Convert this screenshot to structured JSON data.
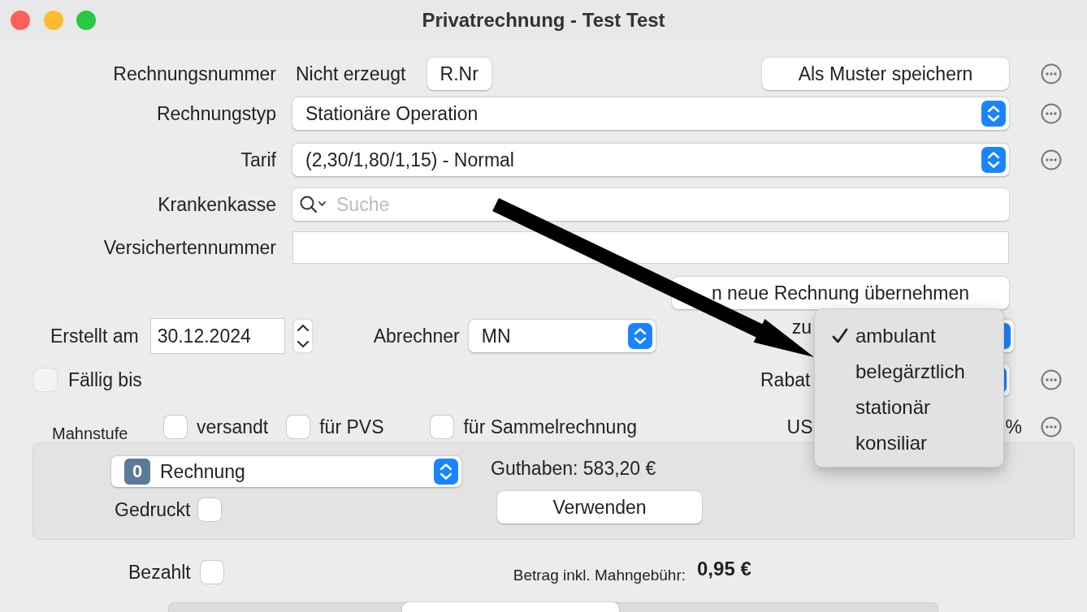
{
  "window": {
    "title": "Privatrechnung - Test Test"
  },
  "invoice_number": {
    "label": "Rechnungsnummer",
    "value": "Nicht erzeugt",
    "button": "R.Nr",
    "template_button": "Als Muster speichern",
    "more": true
  },
  "fields": [
    {
      "label": "Rechnungstyp",
      "kind": "popup",
      "value": "Stationäre Operation",
      "more": true
    },
    {
      "label": "Tarif",
      "kind": "popup",
      "value": "(2,30/1,80/1,15) - Normal",
      "more": true
    },
    {
      "label": "Krankenkasse",
      "kind": "search",
      "placeholder": "Suche",
      "more": false
    },
    {
      "label": "Versichertennummer",
      "kind": "text",
      "more": false
    }
  ],
  "apply_button": "n neue Rechnung übernehmen",
  "created": {
    "label": "Erstellt am",
    "value": "30.12.2024"
  },
  "biller": {
    "label": "Abrechner",
    "value": "MN"
  },
  "deduction": {
    "label": "zu"
  },
  "due": {
    "label": "Fällig bis",
    "checked": false
  },
  "discount": {
    "label": "Rabat"
  },
  "dunning": {
    "label": "Mahnstufe",
    "checks": [
      {
        "label": "versandt",
        "checked": false
      },
      {
        "label": "für PVS",
        "checked": false
      },
      {
        "label": "für Sammelrechnung",
        "checked": false
      }
    ]
  },
  "vat": {
    "label": "US",
    "unit": "%"
  },
  "document": {
    "badge": "0",
    "value": "Rechnung",
    "printed": {
      "label": "Gedruckt",
      "checked": false
    },
    "credit": "Guthaben: 583,20 €",
    "use_button": "Verwenden"
  },
  "paid": {
    "label": "Bezahlt",
    "checked": false
  },
  "amount": {
    "label": "Betrag inkl. Mahngebühr:",
    "value": "0,95 €"
  },
  "tabs": [
    {
      "selected": false
    },
    {
      "selected": true
    },
    {
      "selected": false
    }
  ],
  "menu": {
    "items": [
      {
        "label": "ambulant",
        "selected": true
      },
      {
        "label": "belegärztlich",
        "selected": false
      },
      {
        "label": "stationär",
        "selected": false
      },
      {
        "label": "konsiliar",
        "selected": false
      }
    ]
  }
}
